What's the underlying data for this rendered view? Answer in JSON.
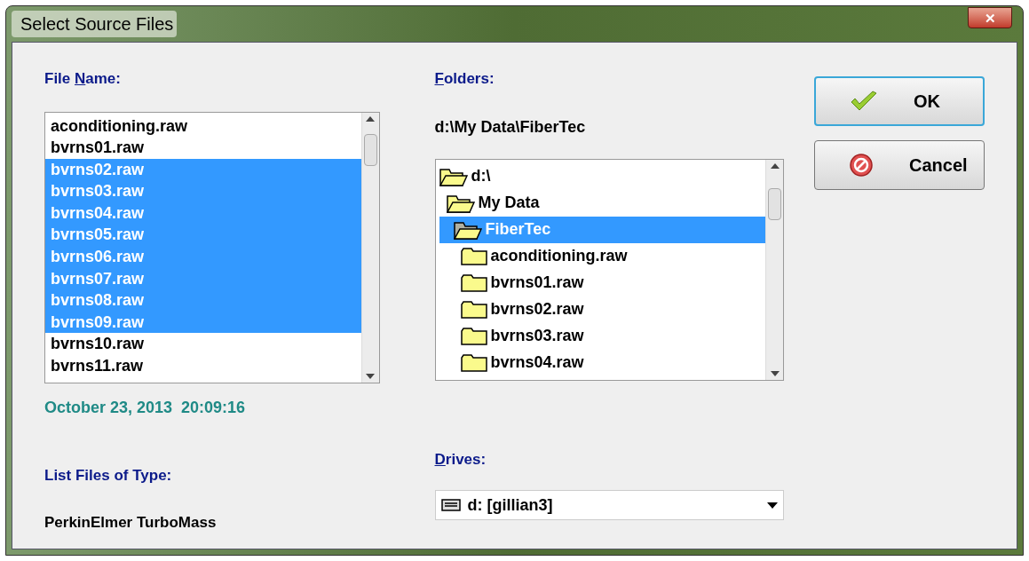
{
  "window": {
    "title": "Select Source Files",
    "close": "✕"
  },
  "file_name": {
    "label": {
      "before": "File ",
      "key": "N",
      "after": "ame:"
    },
    "files": [
      {
        "name": "aconditioning.raw",
        "selected": false
      },
      {
        "name": "bvrns01.raw",
        "selected": false
      },
      {
        "name": "bvrns02.raw",
        "selected": true
      },
      {
        "name": "bvrns03.raw",
        "selected": true
      },
      {
        "name": "bvrns04.raw",
        "selected": true
      },
      {
        "name": "bvrns05.raw",
        "selected": true
      },
      {
        "name": "bvrns06.raw",
        "selected": true
      },
      {
        "name": "bvrns07.raw",
        "selected": true
      },
      {
        "name": "bvrns08.raw",
        "selected": true
      },
      {
        "name": "bvrns09.raw",
        "selected": true
      },
      {
        "name": "bvrns10.raw",
        "selected": false
      },
      {
        "name": "bvrns11.raw",
        "selected": false
      }
    ],
    "timestamp": "October 23, 2013  20:09:16"
  },
  "folders": {
    "label": {
      "key": "F",
      "after": "olders:"
    },
    "path": "d:\\My Data\\FiberTec",
    "tree": [
      {
        "name": "d:\\",
        "kind": "open",
        "selected": false,
        "children": [
          {
            "name": "My Data",
            "kind": "open",
            "selected": false,
            "children": [
              {
                "name": "FiberTec",
                "kind": "current",
                "selected": true,
                "children": [
                  {
                    "name": "aconditioning.raw",
                    "kind": "closed",
                    "selected": false
                  },
                  {
                    "name": "bvrns01.raw",
                    "kind": "closed",
                    "selected": false
                  },
                  {
                    "name": "bvrns02.raw",
                    "kind": "closed",
                    "selected": false
                  },
                  {
                    "name": "bvrns03.raw",
                    "kind": "closed",
                    "selected": false
                  },
                  {
                    "name": "bvrns04.raw",
                    "kind": "closed",
                    "selected": false
                  }
                ]
              }
            ]
          }
        ]
      }
    ]
  },
  "file_type": {
    "label": "List Files of Type:",
    "value": "PerkinElmer TurboMass"
  },
  "drives": {
    "label": {
      "key": "D",
      "after": "rives:"
    },
    "value": "d: [gillian3]"
  },
  "buttons": [
    {
      "label": "OK",
      "kind": "ok",
      "focused": true
    },
    {
      "label": "Cancel",
      "kind": "cancel",
      "focused": false
    }
  ]
}
